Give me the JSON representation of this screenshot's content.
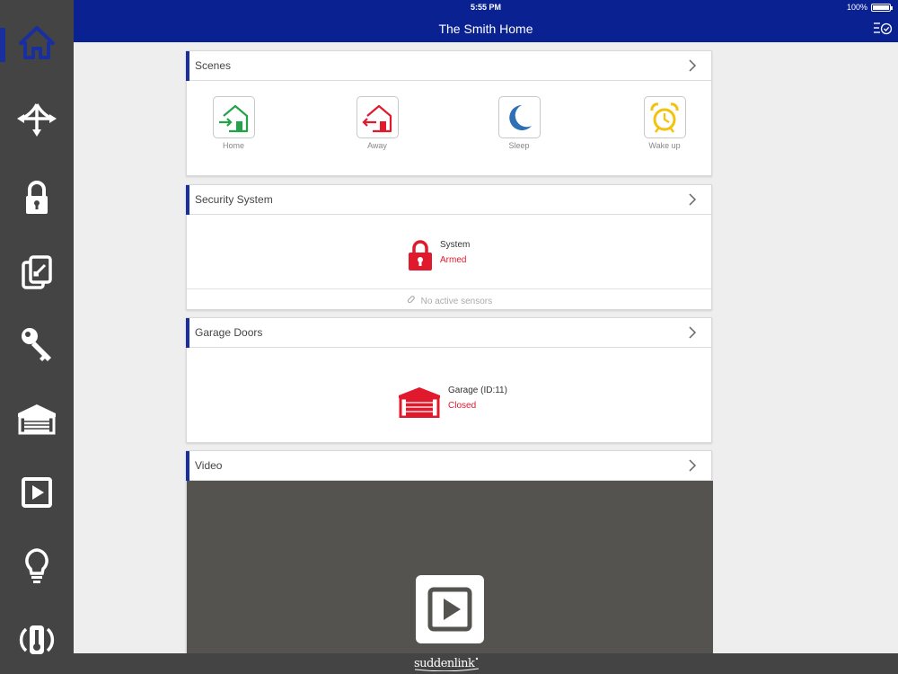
{
  "status_bar": {
    "time": "5:55 PM",
    "battery": "100%",
    "battery_level": 1.0
  },
  "header": {
    "title": "The Smith Home"
  },
  "sidebar": {
    "items": [
      {
        "icon": "home-icon",
        "active": true
      },
      {
        "icon": "arrows-icon",
        "active": false
      },
      {
        "icon": "lock-icon",
        "active": false
      },
      {
        "icon": "tablet-icon",
        "active": false
      },
      {
        "icon": "key-icon",
        "active": false
      },
      {
        "icon": "garage-icon",
        "active": false
      },
      {
        "icon": "video-icon",
        "active": false
      },
      {
        "icon": "lightbulb-icon",
        "active": false
      },
      {
        "icon": "thermostat-icon",
        "active": false
      }
    ]
  },
  "scenes": {
    "title": "Scenes",
    "items": [
      {
        "label": "Home",
        "icon": "home-scene-icon",
        "color": "#22a34a"
      },
      {
        "label": "Away",
        "icon": "away-scene-icon",
        "color": "#e0192d"
      },
      {
        "label": "Sleep",
        "icon": "moon-icon",
        "color": "#2f6fb5"
      },
      {
        "label": "Wake up",
        "icon": "alarm-clock-icon",
        "color": "#f2c20f"
      }
    ]
  },
  "security": {
    "title": "Security System",
    "device_label": "System",
    "device_status": "Armed",
    "sensors_text": "No active sensors"
  },
  "garage": {
    "title": "Garage Doors",
    "device_label": "Garage (ID:11)",
    "device_status": "Closed"
  },
  "video": {
    "title": "Video"
  },
  "footer": {
    "brand": "suddenlink"
  },
  "colors": {
    "header_bg": "#0a2291",
    "accent": "#1a2f9e",
    "sidebar_bg": "#444444",
    "alert_red": "#e0192d"
  }
}
